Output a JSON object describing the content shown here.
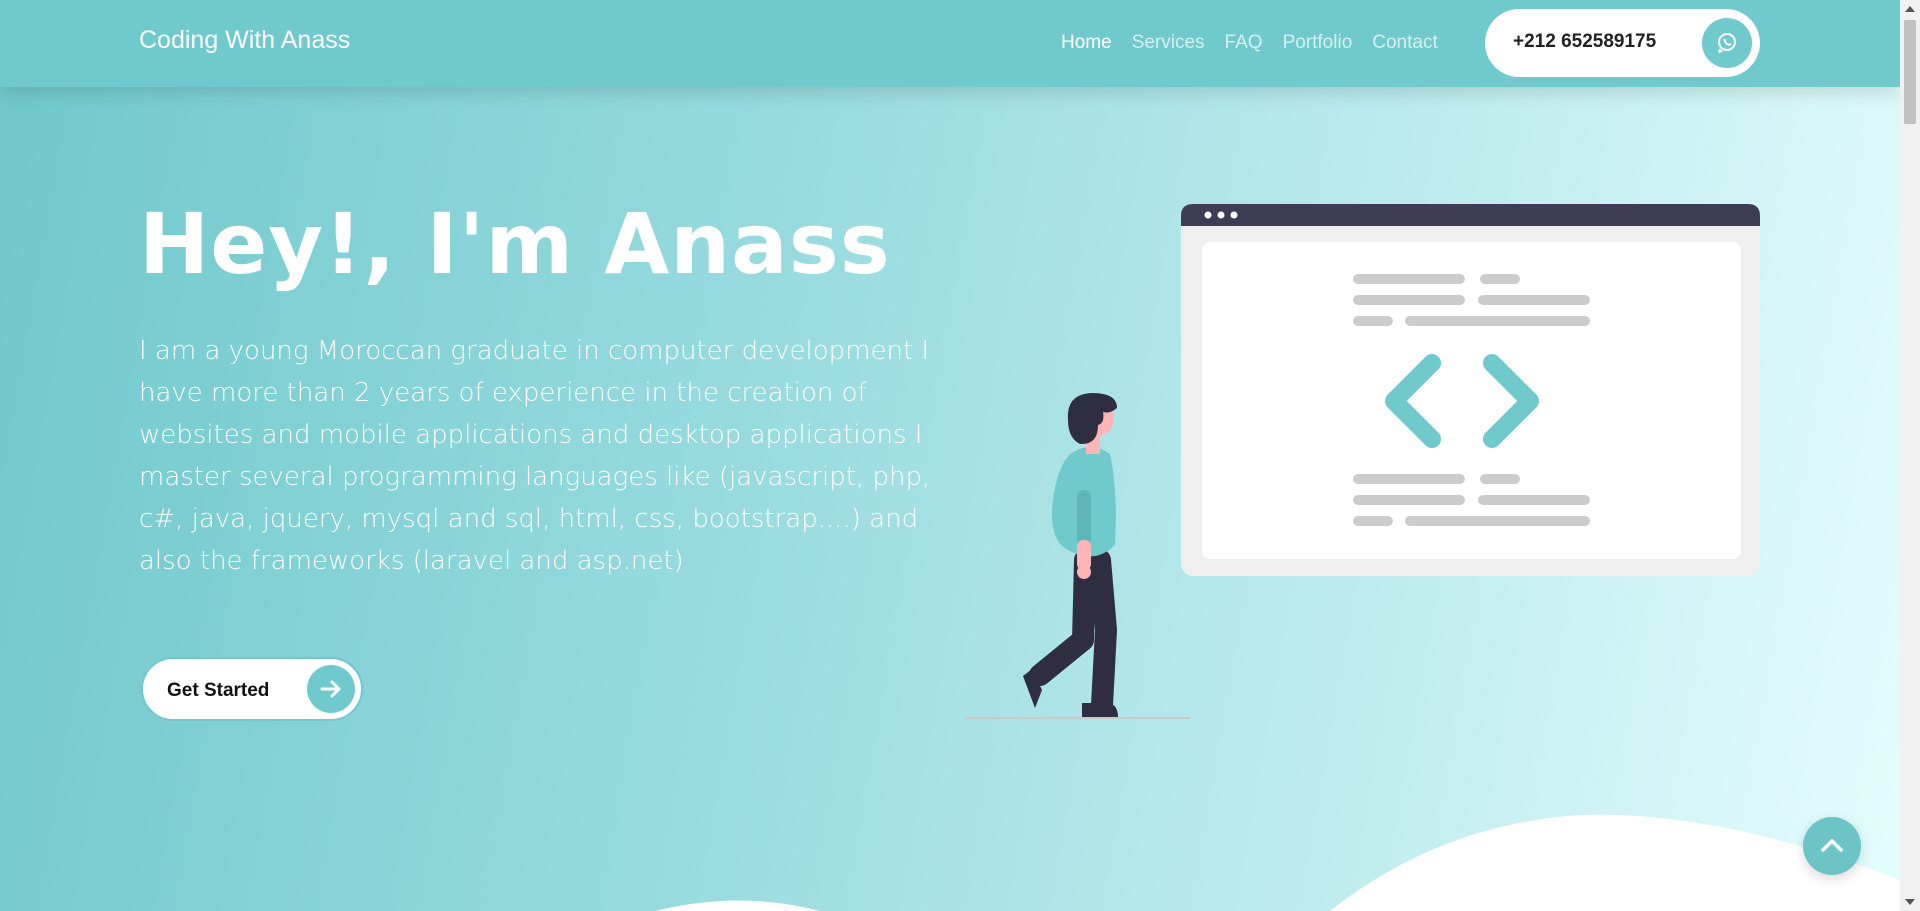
{
  "navbar": {
    "brand": "Coding With Anass",
    "links": [
      "Home",
      "Services",
      "FAQ",
      "Portfolio",
      "Contact"
    ],
    "active_link": "Home",
    "phone": "+212 652589175",
    "phone_icon": "whatsapp-icon"
  },
  "hero": {
    "title": "Hey!, I'm Anass",
    "description": "I am a young Moroccan graduate in computer development I have more than 2 years of experience in the creation of websites and mobile applications and desktop applications I master several programming languages like (javascript, php, c#, java, jquery, mysql and sql, html, css, bootstrap....) and also the frameworks (laravel and asp.net)",
    "cta_label": "Get Started",
    "cta_icon": "arrow-right-icon"
  },
  "scroll_top_icon": "chevron-up-icon",
  "colors": {
    "accent": "#70c9cc",
    "navbar_bg": "#70c9cc",
    "white": "#ffffff",
    "window_bar": "#3f3d56"
  }
}
